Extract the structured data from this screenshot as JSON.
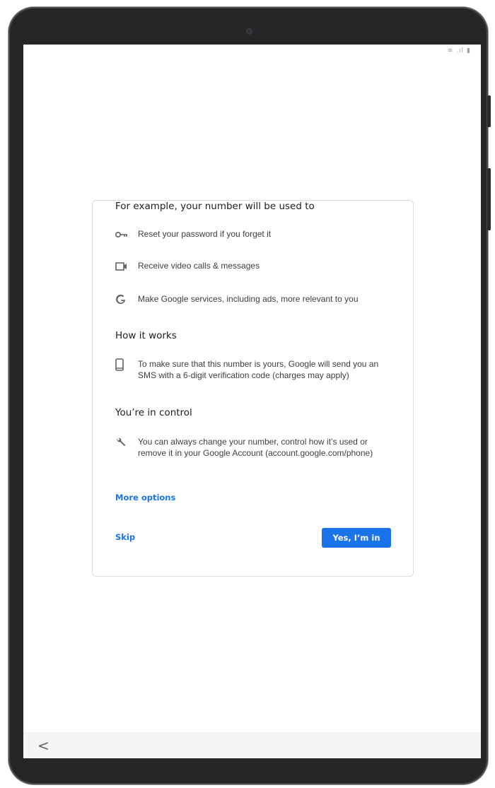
{
  "status_bar": {
    "icons": [
      "wifi-icon",
      "signal-icon",
      "battery-icon"
    ],
    "glyphs": "≋ .ıl ▮"
  },
  "card": {
    "section1": {
      "title": "For example, your number will be used to",
      "items": [
        {
          "icon": "key-icon",
          "text": "Reset your password if you forget it"
        },
        {
          "icon": "video-icon",
          "text": "Receive video calls & messages"
        },
        {
          "icon": "google-icon",
          "text": "Make Google services, including ads, more relevant to you"
        }
      ]
    },
    "section2": {
      "title": "How it works",
      "item": {
        "icon": "phone-icon",
        "text": "To make sure that this number is yours, Google will send you an SMS with a 6-digit verification code (charges may apply)"
      }
    },
    "section3": {
      "title": "You’re in control",
      "item": {
        "icon": "wrench-icon",
        "text": "You can always change your number, control how it’s used or remove it in your Google Account (account.google.com/phone)"
      }
    },
    "more_options": "More options",
    "skip": "Skip",
    "primary_button": "Yes, I’m in"
  },
  "nav": {
    "back_glyph": "<"
  },
  "colors": {
    "accent": "#1a73e8",
    "text": "#202124",
    "secondary": "#5f6368"
  }
}
